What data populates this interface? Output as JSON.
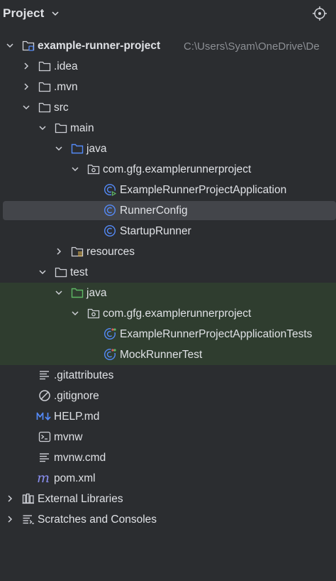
{
  "header": {
    "title": "Project",
    "chevron_icon": "chevron-down-icon",
    "locate_icon": "crosshair-icon"
  },
  "tree": {
    "root": {
      "label": "example-runner-project",
      "path": "C:\\Users\\Syam\\OneDrive\\De"
    },
    "idea": "idea",
    "idea_label": ".idea",
    "mvn_label": ".mvn",
    "src_label": "src",
    "main_label": "main",
    "main_java_label": "java",
    "main_package_label": "com.gfg.examplerunnerproject",
    "app_class_label": "ExampleRunnerProjectApplication",
    "runner_config_label": "RunnerConfig",
    "startup_runner_label": "StartupRunner",
    "resources_label": "resources",
    "test_label": "test",
    "test_java_label": "java",
    "test_package_label": "com.gfg.examplerunnerproject",
    "app_tests_label": "ExampleRunnerProjectApplicationTests",
    "mock_test_label": "MockRunnerTest",
    "gitattributes_label": ".gitattributes",
    "gitignore_label": ".gitignore",
    "help_label": "HELP.md",
    "mvnw_label": "mvnw",
    "mvnw_cmd_label": "mvnw.cmd",
    "pom_label": "pom.xml",
    "external_libraries_label": "External Libraries",
    "scratches_label": "Scratches and Consoles"
  },
  "colors": {
    "background": "#2b2d30",
    "selection": "#43454a",
    "test_highlight": "#2f3d2f",
    "text": "#dfe1e5",
    "path_text": "#8c8f94",
    "java_folder_blue": "#548af7",
    "test_folder_green": "#5fb865",
    "class_icon_blue": "#548af7"
  }
}
